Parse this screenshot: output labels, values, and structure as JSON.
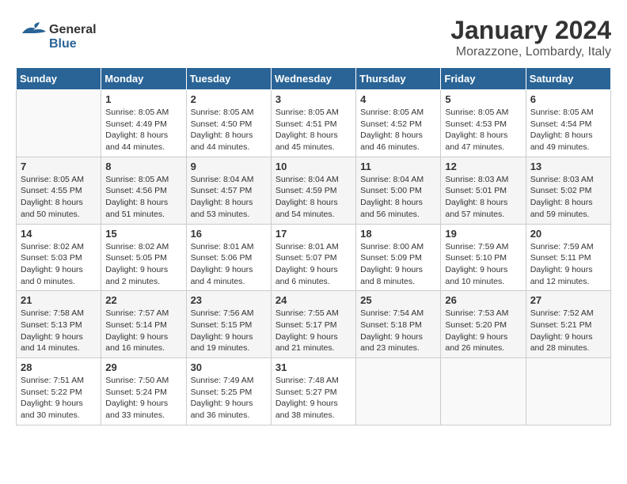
{
  "header": {
    "logo_general": "General",
    "logo_blue": "Blue",
    "month_title": "January 2024",
    "subtitle": "Morazzone, Lombardy, Italy"
  },
  "days_of_week": [
    "Sunday",
    "Monday",
    "Tuesday",
    "Wednesday",
    "Thursday",
    "Friday",
    "Saturday"
  ],
  "weeks": [
    [
      {
        "day": "",
        "sunrise": "",
        "sunset": "",
        "daylight": ""
      },
      {
        "day": "1",
        "sunrise": "Sunrise: 8:05 AM",
        "sunset": "Sunset: 4:49 PM",
        "daylight": "Daylight: 8 hours and 44 minutes."
      },
      {
        "day": "2",
        "sunrise": "Sunrise: 8:05 AM",
        "sunset": "Sunset: 4:50 PM",
        "daylight": "Daylight: 8 hours and 44 minutes."
      },
      {
        "day": "3",
        "sunrise": "Sunrise: 8:05 AM",
        "sunset": "Sunset: 4:51 PM",
        "daylight": "Daylight: 8 hours and 45 minutes."
      },
      {
        "day": "4",
        "sunrise": "Sunrise: 8:05 AM",
        "sunset": "Sunset: 4:52 PM",
        "daylight": "Daylight: 8 hours and 46 minutes."
      },
      {
        "day": "5",
        "sunrise": "Sunrise: 8:05 AM",
        "sunset": "Sunset: 4:53 PM",
        "daylight": "Daylight: 8 hours and 47 minutes."
      },
      {
        "day": "6",
        "sunrise": "Sunrise: 8:05 AM",
        "sunset": "Sunset: 4:54 PM",
        "daylight": "Daylight: 8 hours and 49 minutes."
      }
    ],
    [
      {
        "day": "7",
        "sunrise": "Sunrise: 8:05 AM",
        "sunset": "Sunset: 4:55 PM",
        "daylight": "Daylight: 8 hours and 50 minutes."
      },
      {
        "day": "8",
        "sunrise": "Sunrise: 8:05 AM",
        "sunset": "Sunset: 4:56 PM",
        "daylight": "Daylight: 8 hours and 51 minutes."
      },
      {
        "day": "9",
        "sunrise": "Sunrise: 8:04 AM",
        "sunset": "Sunset: 4:57 PM",
        "daylight": "Daylight: 8 hours and 53 minutes."
      },
      {
        "day": "10",
        "sunrise": "Sunrise: 8:04 AM",
        "sunset": "Sunset: 4:59 PM",
        "daylight": "Daylight: 8 hours and 54 minutes."
      },
      {
        "day": "11",
        "sunrise": "Sunrise: 8:04 AM",
        "sunset": "Sunset: 5:00 PM",
        "daylight": "Daylight: 8 hours and 56 minutes."
      },
      {
        "day": "12",
        "sunrise": "Sunrise: 8:03 AM",
        "sunset": "Sunset: 5:01 PM",
        "daylight": "Daylight: 8 hours and 57 minutes."
      },
      {
        "day": "13",
        "sunrise": "Sunrise: 8:03 AM",
        "sunset": "Sunset: 5:02 PM",
        "daylight": "Daylight: 8 hours and 59 minutes."
      }
    ],
    [
      {
        "day": "14",
        "sunrise": "Sunrise: 8:02 AM",
        "sunset": "Sunset: 5:03 PM",
        "daylight": "Daylight: 9 hours and 0 minutes."
      },
      {
        "day": "15",
        "sunrise": "Sunrise: 8:02 AM",
        "sunset": "Sunset: 5:05 PM",
        "daylight": "Daylight: 9 hours and 2 minutes."
      },
      {
        "day": "16",
        "sunrise": "Sunrise: 8:01 AM",
        "sunset": "Sunset: 5:06 PM",
        "daylight": "Daylight: 9 hours and 4 minutes."
      },
      {
        "day": "17",
        "sunrise": "Sunrise: 8:01 AM",
        "sunset": "Sunset: 5:07 PM",
        "daylight": "Daylight: 9 hours and 6 minutes."
      },
      {
        "day": "18",
        "sunrise": "Sunrise: 8:00 AM",
        "sunset": "Sunset: 5:09 PM",
        "daylight": "Daylight: 9 hours and 8 minutes."
      },
      {
        "day": "19",
        "sunrise": "Sunrise: 7:59 AM",
        "sunset": "Sunset: 5:10 PM",
        "daylight": "Daylight: 9 hours and 10 minutes."
      },
      {
        "day": "20",
        "sunrise": "Sunrise: 7:59 AM",
        "sunset": "Sunset: 5:11 PM",
        "daylight": "Daylight: 9 hours and 12 minutes."
      }
    ],
    [
      {
        "day": "21",
        "sunrise": "Sunrise: 7:58 AM",
        "sunset": "Sunset: 5:13 PM",
        "daylight": "Daylight: 9 hours and 14 minutes."
      },
      {
        "day": "22",
        "sunrise": "Sunrise: 7:57 AM",
        "sunset": "Sunset: 5:14 PM",
        "daylight": "Daylight: 9 hours and 16 minutes."
      },
      {
        "day": "23",
        "sunrise": "Sunrise: 7:56 AM",
        "sunset": "Sunset: 5:15 PM",
        "daylight": "Daylight: 9 hours and 19 minutes."
      },
      {
        "day": "24",
        "sunrise": "Sunrise: 7:55 AM",
        "sunset": "Sunset: 5:17 PM",
        "daylight": "Daylight: 9 hours and 21 minutes."
      },
      {
        "day": "25",
        "sunrise": "Sunrise: 7:54 AM",
        "sunset": "Sunset: 5:18 PM",
        "daylight": "Daylight: 9 hours and 23 minutes."
      },
      {
        "day": "26",
        "sunrise": "Sunrise: 7:53 AM",
        "sunset": "Sunset: 5:20 PM",
        "daylight": "Daylight: 9 hours and 26 minutes."
      },
      {
        "day": "27",
        "sunrise": "Sunrise: 7:52 AM",
        "sunset": "Sunset: 5:21 PM",
        "daylight": "Daylight: 9 hours and 28 minutes."
      }
    ],
    [
      {
        "day": "28",
        "sunrise": "Sunrise: 7:51 AM",
        "sunset": "Sunset: 5:22 PM",
        "daylight": "Daylight: 9 hours and 30 minutes."
      },
      {
        "day": "29",
        "sunrise": "Sunrise: 7:50 AM",
        "sunset": "Sunset: 5:24 PM",
        "daylight": "Daylight: 9 hours and 33 minutes."
      },
      {
        "day": "30",
        "sunrise": "Sunrise: 7:49 AM",
        "sunset": "Sunset: 5:25 PM",
        "daylight": "Daylight: 9 hours and 36 minutes."
      },
      {
        "day": "31",
        "sunrise": "Sunrise: 7:48 AM",
        "sunset": "Sunset: 5:27 PM",
        "daylight": "Daylight: 9 hours and 38 minutes."
      },
      {
        "day": "",
        "sunrise": "",
        "sunset": "",
        "daylight": ""
      },
      {
        "day": "",
        "sunrise": "",
        "sunset": "",
        "daylight": ""
      },
      {
        "day": "",
        "sunrise": "",
        "sunset": "",
        "daylight": ""
      }
    ]
  ]
}
